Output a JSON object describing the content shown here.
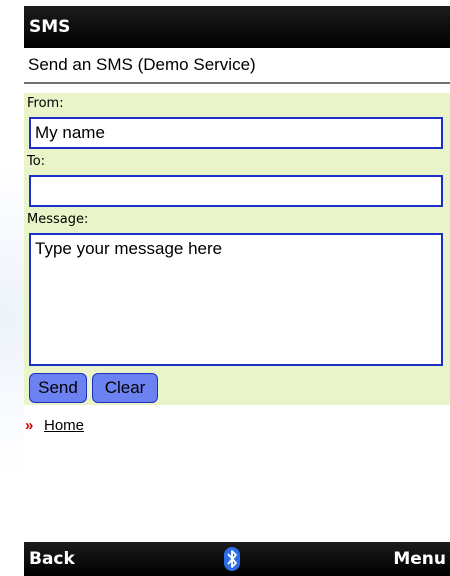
{
  "titlebar": {
    "title": "SMS"
  },
  "page": {
    "subtitle": "Send an SMS (Demo Service)"
  },
  "form": {
    "from_label": "From:",
    "from_value": "My name",
    "to_label": "To:",
    "to_value": "",
    "message_label": "Message:",
    "message_value": "Type your message here"
  },
  "buttons": {
    "send_label": "Send",
    "clear_label": "Clear"
  },
  "links": {
    "home_arrows": "»",
    "home_label": "Home"
  },
  "softkeys": {
    "left": "Back",
    "right": "Menu",
    "center_icon": "bluetooth-icon"
  },
  "colors": {
    "bar_bg": "#000000",
    "form_bg": "#eaf4c9",
    "field_border": "#1b2fc8",
    "button_bg": "#6c82f2",
    "link_arrow": "#cc0000"
  }
}
